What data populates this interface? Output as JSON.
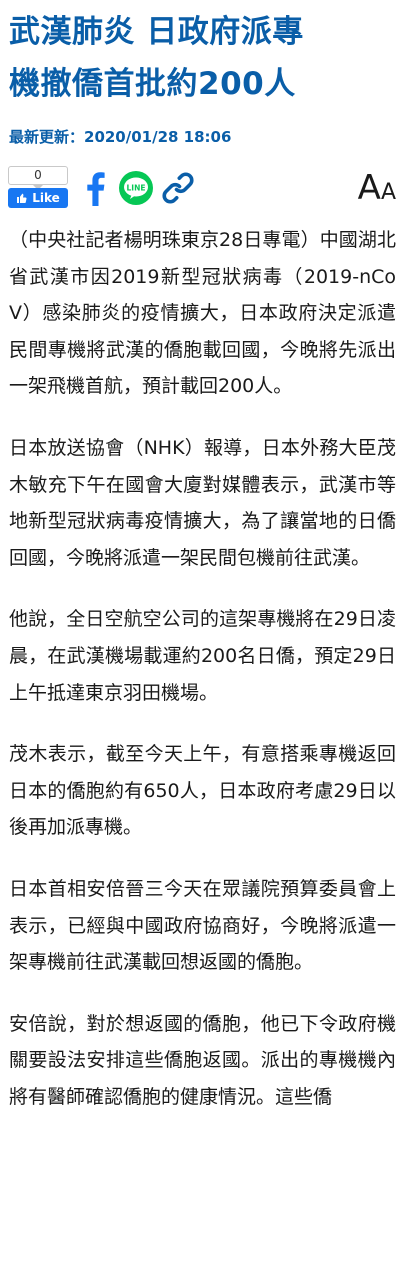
{
  "headline": {
    "line1": "武漢肺炎 日政府派專",
    "line2": "機撤僑首批約200人"
  },
  "updated": "最新更新：2020/01/28 18:06",
  "share": {
    "fb_count": "0",
    "fb_like_label": "Like",
    "line_label": "LINE",
    "font_big": "A",
    "font_small": "A"
  },
  "colors": {
    "accent": "#0a5ea8",
    "facebook": "#1877f2",
    "line": "#06c755"
  },
  "article": {
    "paragraphs": [
      "（中央社記者楊明珠東京28日專電）中國湖北省武漢市因2019新型冠狀病毒（2019-nCoV）感染肺炎的疫情擴大，日本政府決定派遣民間專機將武漢的僑胞載回國，今晚將先派出一架飛機首航，預計載回200人。",
      "日本放送協會（NHK）報導，日本外務大臣茂木敏充下午在國會大廈對媒體表示，武漢市等地新型冠狀病毒疫情擴大，為了讓當地的日僑回國，今晚將派遣一架民間包機前往武漢。",
      "他說，全日空航空公司的這架專機將在29日凌晨，在武漢機場載運約200名日僑，預定29日上午抵達東京羽田機場。",
      "茂木表示，截至今天上午，有意搭乘專機返回日本的僑胞約有650人，日本政府考慮29日以後再加派專機。",
      "日本首相安倍晉三今天在眾議院預算委員會上表示，已經與中國政府協商好，今晚將派遣一架專機前往武漢載回想返國的僑胞。",
      "安倍說，對於想返國的僑胞，他已下令政府機關要設法安排這些僑胞返國。派出的專機機內將有醫師確認僑胞的健康情況。這些僑"
    ]
  }
}
